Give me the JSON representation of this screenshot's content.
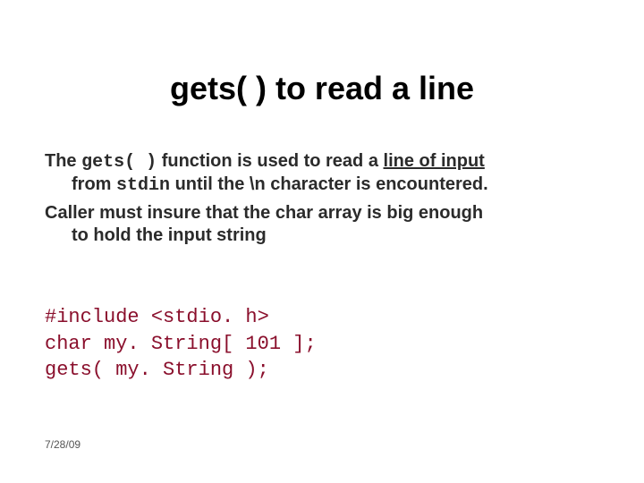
{
  "title": "gets( ) to read a line",
  "para1": {
    "pre": "The ",
    "code1": "gets( )",
    "mid1": " function is used to read a ",
    "ul": "line of input",
    "cont_pre": "from ",
    "code2": "stdin",
    "cont_post": " until the \\n character is encountered."
  },
  "para2": {
    "line1": "Caller must insure that the char array is big enough",
    "line2": "to hold the input string"
  },
  "code": {
    "l1": "#include <stdio. h>",
    "l2": "char my. String[ 101 ];",
    "l3": "gets( my. String );"
  },
  "footer": "7/28/09"
}
